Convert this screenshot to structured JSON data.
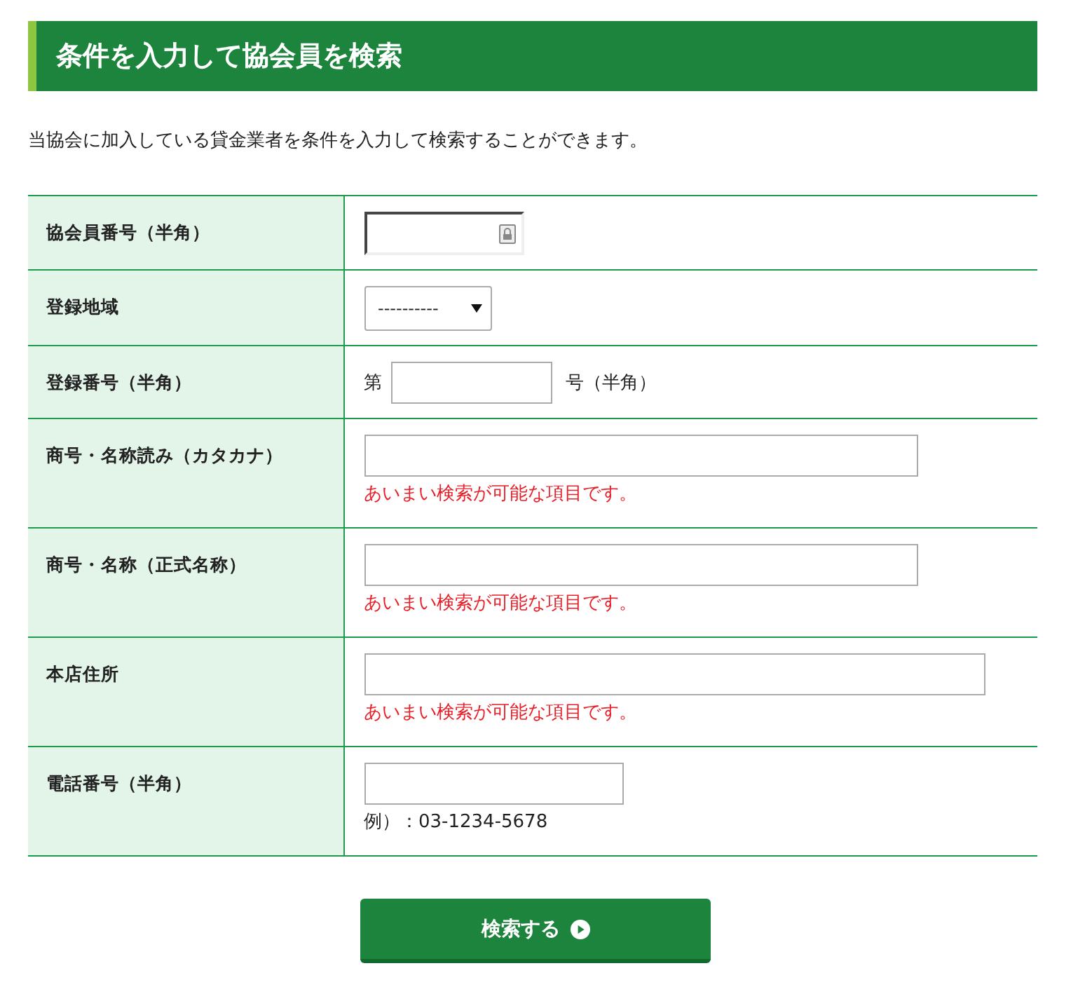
{
  "heading": "条件を入力して協会員を検索",
  "intro": "当協会に加入している貸金業者を条件を入力して検索することができます。",
  "rows": [
    {
      "label": "協会員番号（半角）",
      "field": {
        "kind": "id"
      }
    },
    {
      "label": "登録地域",
      "field": {
        "kind": "select",
        "value": "----------"
      }
    },
    {
      "label": "登録番号（半角）",
      "field": {
        "kind": "numbered",
        "prefix": "第",
        "suffix": "号（半角）"
      }
    },
    {
      "label": "商号・名称読み（カタカナ）",
      "field": {
        "kind": "text"
      },
      "note": {
        "kind": "warning",
        "text": "あいまい検索が可能な項目です。"
      }
    },
    {
      "label": "商号・名称（正式名称）",
      "field": {
        "kind": "text"
      },
      "note": {
        "kind": "warning",
        "text": "あいまい検索が可能な項目です。"
      }
    },
    {
      "label": "本店住所",
      "field": {
        "kind": "text"
      },
      "note": {
        "kind": "warning",
        "text": "あいまい検索が可能な項目です。"
      }
    },
    {
      "label": "電話番号（半角）",
      "field": {
        "kind": "text"
      },
      "note": {
        "kind": "example",
        "text": "例）：03-1234-5678"
      }
    }
  ],
  "button": "検索する"
}
